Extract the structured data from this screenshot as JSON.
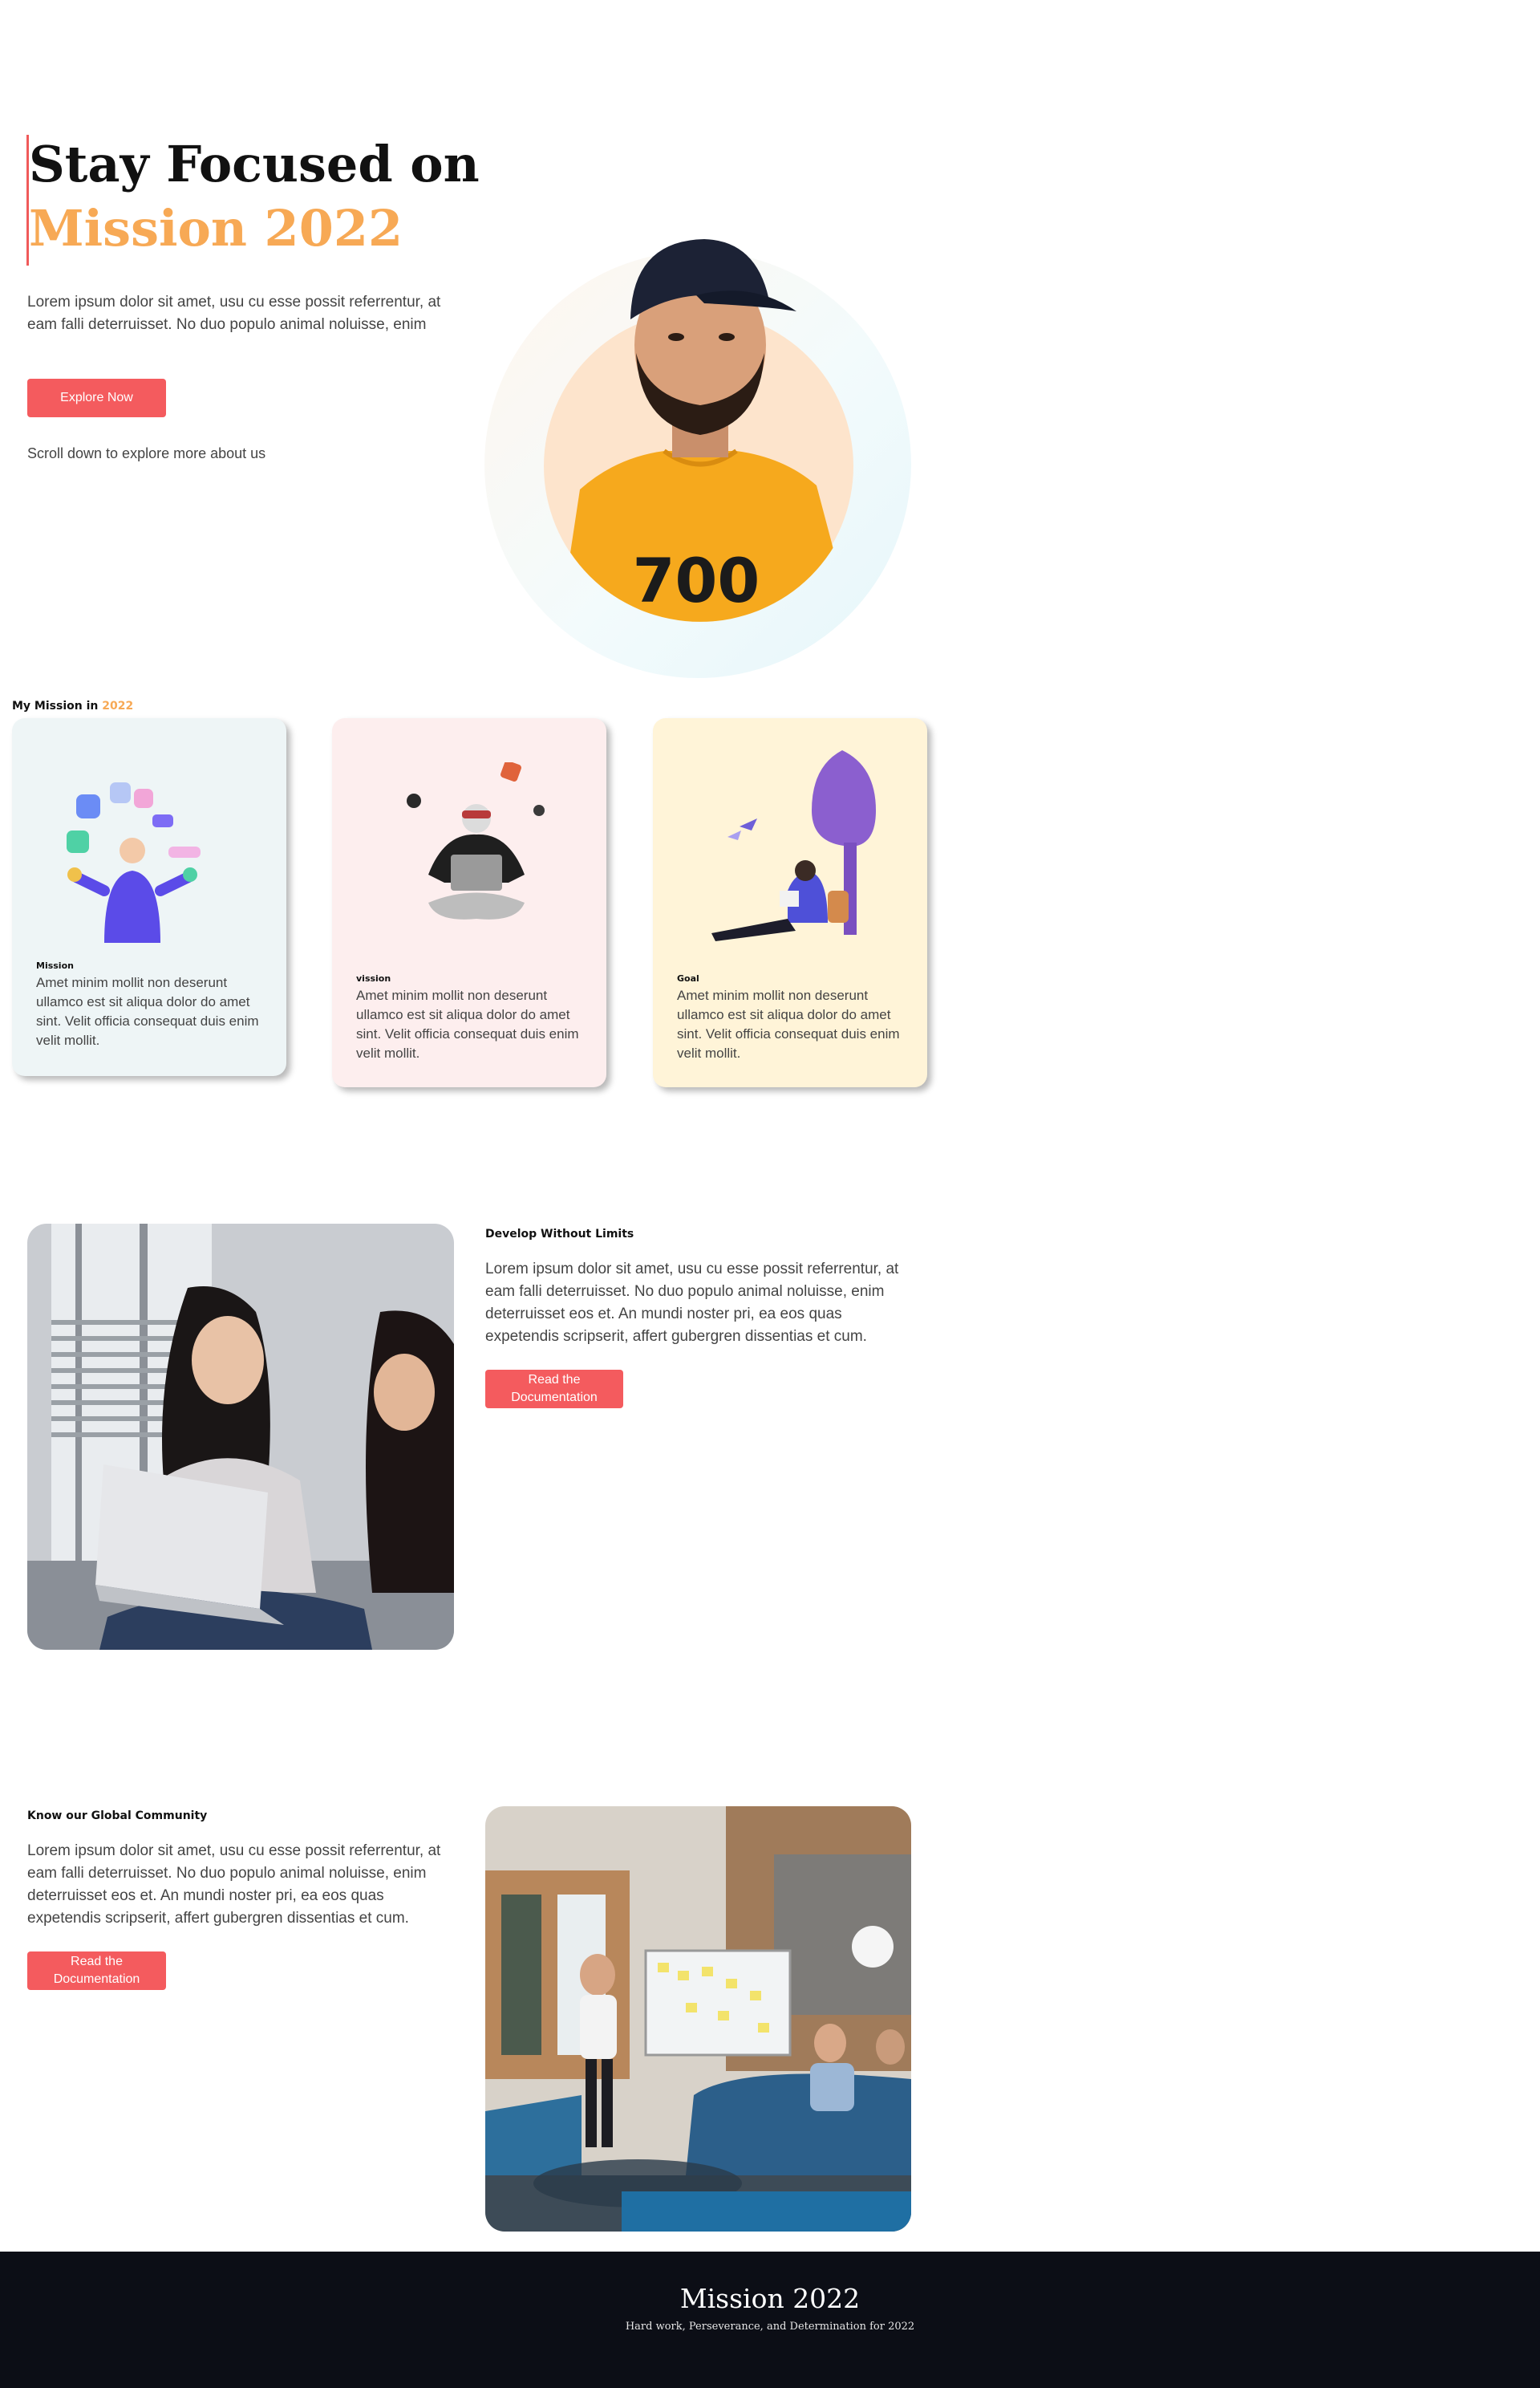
{
  "hero": {
    "title_line1": "Stay Focused on",
    "title_line2": "Mission 2022",
    "description": "Lorem ipsum dolor sit amet, usu cu esse possit referrentur, at eam falli deterruisset. No duo populo animal noluisse, enim",
    "button_label": "Explore Now",
    "scroll_hint": "Scroll down to explore more about us",
    "shirt_text": "700"
  },
  "mission_section": {
    "heading_prefix": "My Mission in",
    "heading_year": "2022",
    "cards": [
      {
        "title": "Mission",
        "text": "Amet minim mollit non deserunt ullamco est sit aliqua dolor do amet sint. Velit officia consequat duis enim velit mollit."
      },
      {
        "title": "vission",
        "text": "Amet minim mollit non deserunt ullamco est sit aliqua dolor do amet sint. Velit officia consequat duis enim velit mollit."
      },
      {
        "title": "Goal",
        "text": "Amet minim mollit non deserunt ullamco est sit aliqua dolor do amet sint. Velit officia consequat duis enim velit mollit."
      }
    ]
  },
  "develop_section": {
    "heading": "Develop Without Limits",
    "text": "Lorem ipsum dolor sit amet, usu cu esse possit referrentur, at eam falli deterruisset. No duo populo animal noluisse, enim deterruisset eos et. An mundi noster pri, ea eos quas expetendis scripserit, affert gubergren dissentias et cum.",
    "button_label": "Read the Documentation"
  },
  "community_section": {
    "heading": "Know our Global Community",
    "text": "Lorem ipsum dolor sit amet, usu cu esse possit referrentur, at eam falli deterruisset. No duo populo animal noluisse, enim deterruisset eos et. An mundi noster pri, ea eos quas expetendis scripserit, affert gubergren dissentias et cum.",
    "button_label": "Read the Documentation"
  },
  "footer": {
    "title": "Mission 2022",
    "subtitle": "Hard work, Perseverance, and Determination for 2022"
  },
  "colors": {
    "accent_orange": "#f7a955",
    "button_red": "#f45b5e",
    "footer_bg": "#0c0e16"
  }
}
